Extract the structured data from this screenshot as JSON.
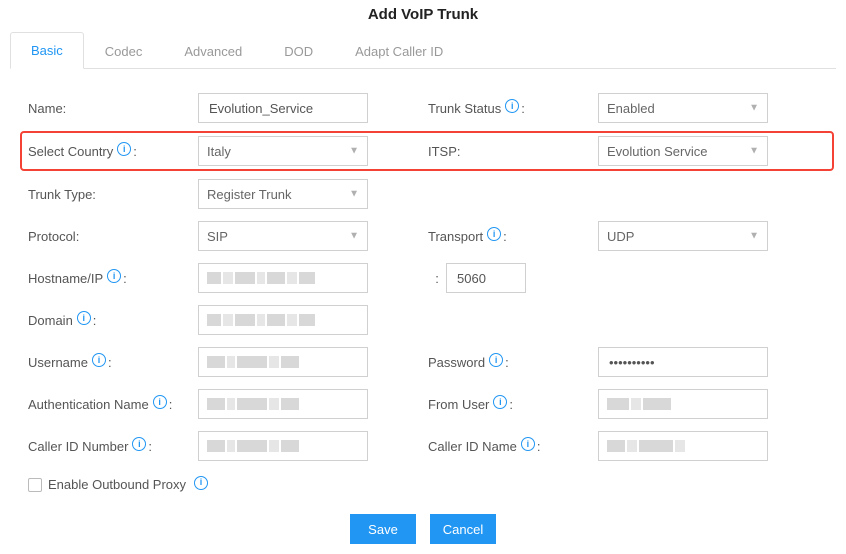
{
  "title": "Add VoIP Trunk",
  "tabs": {
    "basic": "Basic",
    "codec": "Codec",
    "advanced": "Advanced",
    "dod": "DOD",
    "adapt_caller_id": "Adapt Caller ID"
  },
  "labels": {
    "name": "Name:",
    "trunk_status": "Trunk Status",
    "select_country": "Select Country",
    "itsp": "ITSP:",
    "trunk_type": "Trunk Type:",
    "protocol": "Protocol:",
    "transport": "Transport",
    "hostname_ip": "Hostname/IP",
    "domain": "Domain",
    "username": "Username",
    "password": "Password",
    "auth_name": "Authentication Name",
    "from_user": "From User",
    "caller_id_number": "Caller ID Number",
    "caller_id_name": "Caller ID Name",
    "enable_outbound_proxy": "Enable Outbound Proxy"
  },
  "values": {
    "name": "Evolution_Service",
    "trunk_status": "Enabled",
    "select_country": "Italy",
    "itsp": "Evolution Service",
    "trunk_type": "Register Trunk",
    "protocol": "SIP",
    "transport": "UDP",
    "hostname_ip": "",
    "port": "5060",
    "domain": "",
    "username": "",
    "password": "••••••••••",
    "auth_name": "",
    "from_user": "",
    "caller_id_number": "",
    "caller_id_name": "",
    "enable_outbound_proxy": false,
    "colon": ":"
  },
  "buttons": {
    "save": "Save",
    "cancel": "Cancel"
  }
}
